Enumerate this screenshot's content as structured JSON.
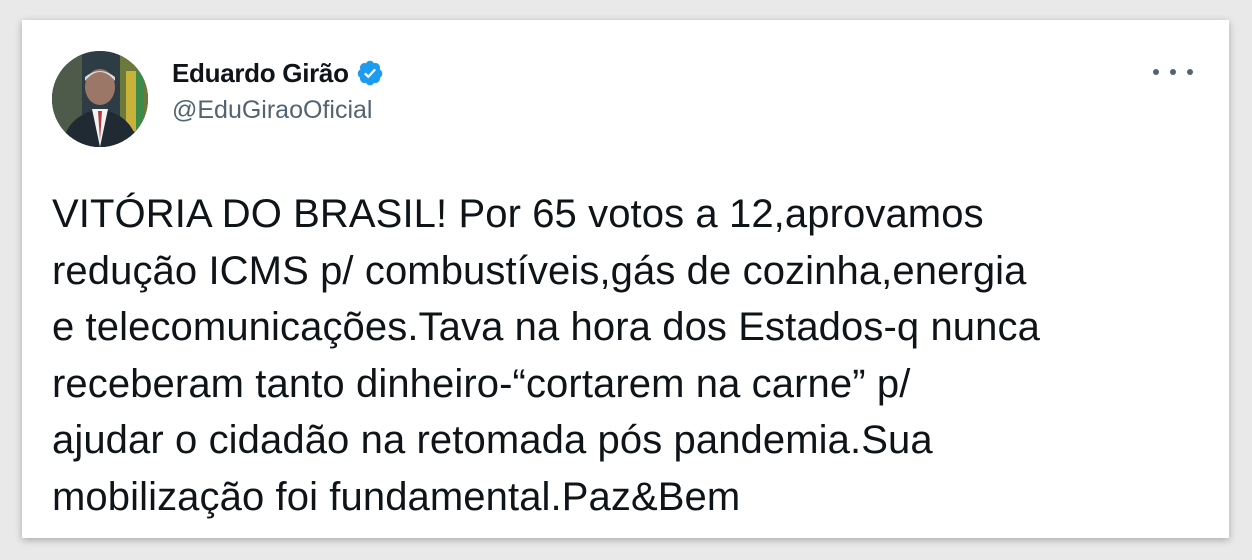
{
  "tweet": {
    "author": {
      "display_name": "Eduardo Girão",
      "handle": "@EduGiraoOficial",
      "verified_icon": "verified-badge-icon",
      "avatar": "profile-photo"
    },
    "more_icon": "more-options-icon",
    "text": "VITÓRIA DO BRASIL! Por 65 votos a 12,aprovamos\nredução ICMS p/ combustíveis,gás de cozinha,energia\ne telecomunicações.Tava na hora dos Estados-q nunca\nreceberam tanto dinheiro-“cortarem na carne” p/\najudar o cidadão na retomada pós pandemia.Sua\nmobilização foi fundamental.Paz&Bem"
  },
  "colors": {
    "verified_blue": "#1d9bf0",
    "text_primary": "#0f1419",
    "text_secondary": "#536471",
    "card_background": "#ffffff",
    "page_background": "#e9e9e9"
  }
}
